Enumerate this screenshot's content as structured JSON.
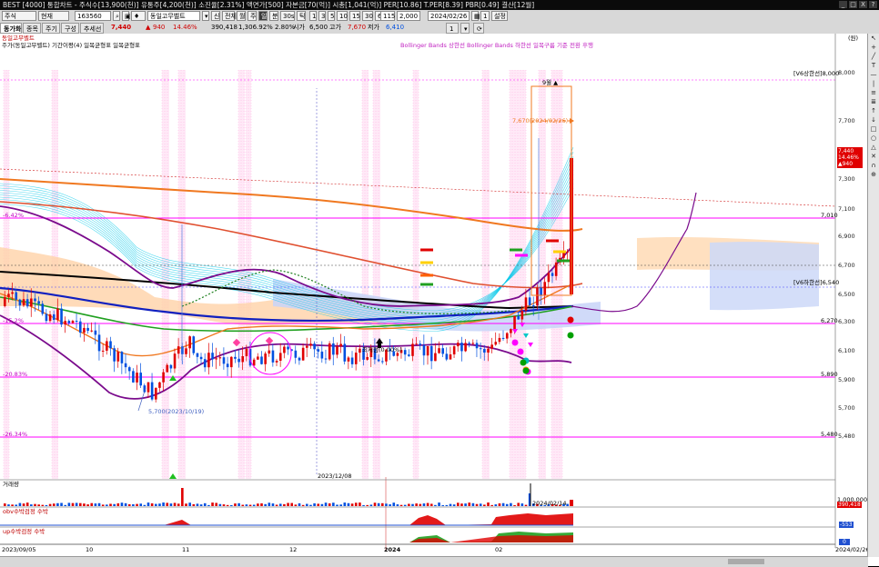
{
  "titlebar": {
    "text": "BEST [4000] 통합차트 - 주식수[13,900(천)] 유통주[4,200(천)] 소진율[2.31%] 액면가[500] 자본금[70(억)] 시총[1,041(억)] PER[10.86] T.PER[8.39] PBR[0.49] 결산[12월]",
    "buttons": [
      "_",
      "□",
      "X",
      "?"
    ]
  },
  "toolbar": {
    "field1": "주식",
    "field2": "현재",
    "code": "163560",
    "name": "동일고무벨트",
    "tabs": [
      "신",
      "전체",
      "월",
      "주",
      "일",
      "분",
      "30s",
      "틱"
    ],
    "periods": [
      "1",
      "3",
      "5",
      "10",
      "15",
      "30",
      "60"
    ],
    "count": "115",
    "viewcount": "2,000",
    "date": "2024/02/26",
    "unit": "1",
    "setting": "설정"
  },
  "toolbar2": {
    "tabs": [
      "동가화",
      "종목",
      "주기",
      "구성",
      "추세선"
    ],
    "price_label": "7,440",
    "change": "940",
    "change_pct": "14.46%",
    "volume": "390,418",
    "vol_pct": "1,306.92%",
    "turnover": "2.80%",
    "open_label": "시가",
    "open": "6,500",
    "high_label": "고가",
    "high": "7,670",
    "low_label": "저가",
    "low": "6,410",
    "option_value": "1"
  },
  "chart": {
    "stock_name": "동일고무벨트",
    "indicator_line1": "주가(동일고무벨트) 기간이평(4) 일목균형표 일목균형표",
    "indicator_line2": "Bollinger Bands 상한선 Bollinger Bands 하한선 일목구름 기준 전환 후행",
    "left_pct_top": "-6.42%",
    "left_pct_mid": "-15.2%",
    "left_pct_low": "-20.83%",
    "left_pct_bottom": "-26.34%",
    "price_axis": [
      "8,000",
      "7,700",
      "7,300",
      "7,100",
      "6,900",
      "6,700",
      "6,500",
      "6,300",
      "6,100",
      "5,900",
      "5,700",
      "5,480"
    ],
    "unit_label": "(원)",
    "level_labels": {
      "upper_limit": "[V6상한선]8,000",
      "level_7010": "7,010",
      "level_6540": "[V6하한선]6,540",
      "level_6270": "6,270",
      "level_5890": "5,890",
      "level_5480": "5,480"
    },
    "current_box": [
      "7,440",
      "14.46%",
      "▲940"
    ],
    "annotation_low": "5,700(2023/10/19)",
    "annotation_high": "7,670(2024/02/26)",
    "annotation_month": "9월 ▲",
    "annotation_bottom": "최저점(0.00%)",
    "date_marker": "2023/12/08",
    "date_marker2": "2024/02/14",
    "volume_label": "거래량",
    "volume_value": "390,418",
    "volume_scale": "1,000,000",
    "obv_label": "obv수박검정 수박",
    "obv_value": "-553",
    "ugp_label": "up수박검정 수박",
    "ugp_value": "0",
    "x_axis": [
      "2023/09/05",
      "10",
      "11",
      "12",
      "2024",
      "02",
      "2024/02/26"
    ]
  },
  "sidebar_icons": [
    "cursor-icon",
    "crosshair-icon",
    "line-icon",
    "text-icon"
  ],
  "colors": {
    "bg": "#ffffff",
    "up": "#e00000",
    "down": "#0050e0",
    "magenta": "#ff00ff",
    "purple": "#7a0a8c",
    "cyan": "#00c8e8",
    "orange": "#f07820",
    "green": "#20a020",
    "navy": "#1020c0"
  }
}
